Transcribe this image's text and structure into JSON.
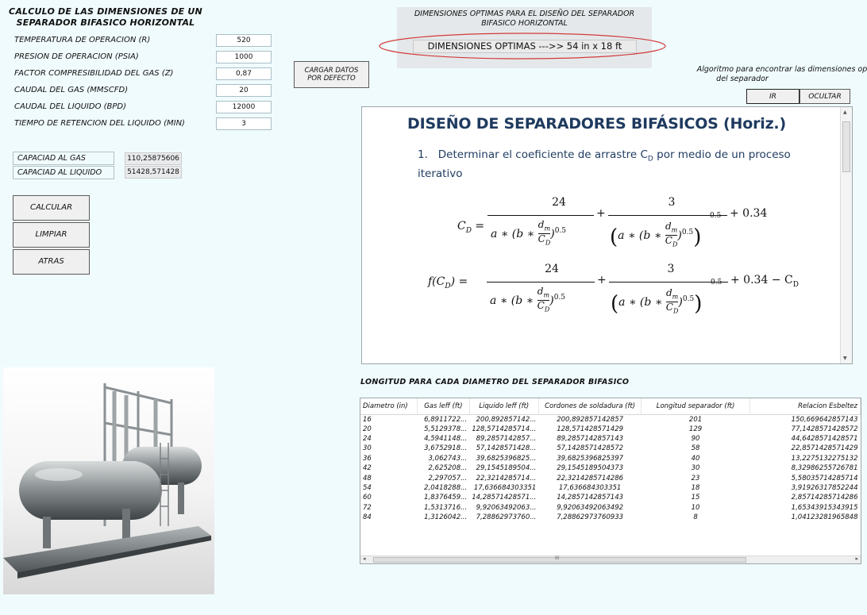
{
  "form": {
    "title": "CALCULO DE LAS DIMENSIONES DE UN SEPARADOR BIFASICO HORIZONTAL",
    "params": [
      {
        "label": "TEMPERATURA DE OPERACION (R)",
        "value": "520"
      },
      {
        "label": "PRESION DE OPERACION (PSIA)",
        "value": "1000"
      },
      {
        "label": "FACTOR COMPRESIBILIDAD DEL GAS (Z)",
        "value": "0,87"
      },
      {
        "label": "CAUDAL DEL GAS (MMSCFD)",
        "value": "20"
      },
      {
        "label": "CAUDAL DEL LIQUIDO (BPD)",
        "value": "12000"
      },
      {
        "label": "TIEMPO DE RETENCION DEL LIQUIDO (MIN)",
        "value": "3"
      }
    ],
    "capacities": [
      {
        "label": "CAPACIAD AL GAS",
        "value": "110,25875606"
      },
      {
        "label": "CAPACIAD AL LIQUIDO",
        "value": "51428,571428"
      }
    ],
    "buttons": {
      "calcular": "CALCULAR",
      "limpiar": "LIMPIAR",
      "atras": "ATRAS",
      "cargar": "CARGAR DATOS POR DEFECTO"
    }
  },
  "optimal": {
    "title": "DIMENSIONES OPTIMAS PARA EL DISEÑO DEL SEPARADOR BIFASICO HORIZONTAL",
    "value": "DIMENSIONES OPTIMAS --->> 54 in  x 18 ft"
  },
  "algorithm": {
    "text_line1": "Algoritmo para encontrar las dimensiones op",
    "text_line2": "del separador",
    "ir": "IR",
    "ocultar": "OCULTAR"
  },
  "document": {
    "title": "DISEÑO DE SEPARADORES BIFÁSICOS (Horiz.)",
    "step_num": "1.",
    "step_text_a": "Determinar el coeficiente de arrastre C",
    "step_sub": "D",
    "step_text_b": " por medio de un proceso iterativo",
    "formula1": {
      "lhs": "C",
      "lhs_sub": "D",
      "n1": "24",
      "n2": "3",
      "tail": "+ 0.34"
    },
    "formula2": {
      "lhs": "f(C",
      "lhs_sub": "D",
      "lhs_close": ")",
      "n1": "24",
      "n2": "3",
      "tail": "+ 0.34 − C",
      "tail_sub": "D"
    },
    "f_a": "a",
    "f_b": "b",
    "f_dm": "d",
    "f_dm_sub": "m",
    "f_cd": "C",
    "f_cd_sub": "D",
    "f_exp": "0.5",
    "f_star": "∗"
  },
  "table": {
    "title": "LONGITUD PARA CADA DIAMETRO DEL SEPARADOR BIFASICO",
    "headers": [
      "Diametro (in)",
      "Gas leff (ft)",
      "Liquido leff (ft)",
      "Cordones de soldadura (ft)",
      "Longitud separador (ft)",
      "Relacion Esbeltez"
    ],
    "rows": [
      [
        "16",
        "6,8911722...",
        "200,892857142...",
        "200,892857142857",
        "201",
        "150,669642857143"
      ],
      [
        "20",
        "5,5129378...",
        "128,5714285714...",
        "128,571428571429",
        "129",
        "77,1428571428572"
      ],
      [
        "24",
        "4,5941148...",
        "89,2857142857...",
        "89,2857142857143",
        "90",
        "44,6428571428571"
      ],
      [
        "30",
        "3,6752918...",
        "57,1428571428...",
        "57,1428571428572",
        "58",
        "22,8571428571429"
      ],
      [
        "36",
        "3,062743...",
        "39,6825396825...",
        "39,6825396825397",
        "40",
        "13,2275132275132"
      ],
      [
        "42",
        "2,625208...",
        "29,1545189504...",
        "29,1545189504373",
        "30",
        "8,32986255726781"
      ],
      [
        "48",
        "2,297057...",
        "22,3214285714...",
        "22,3214285714286",
        "23",
        "5,58035714285714"
      ],
      [
        "54",
        "2,0418288...",
        "17,636684303351",
        "17,636684303351",
        "18",
        "3,91926317852244"
      ],
      [
        "60",
        "1,8376459...",
        "14,28571428571...",
        "14,2857142857143",
        "15",
        "2,85714285714286"
      ],
      [
        "72",
        "1,5313716...",
        "9,92063492063...",
        "9,92063492063492",
        "10",
        "1,65343915343915"
      ],
      [
        "84",
        "1,3126042...",
        "7,28862973760...",
        "7,28862973760933",
        "8",
        "1,04123281965848"
      ]
    ],
    "scroll_mark": "III"
  },
  "colors": {
    "background": "#f0fbfd",
    "ellipse": "#d23a3a",
    "doc_text": "#1e3a5f"
  }
}
